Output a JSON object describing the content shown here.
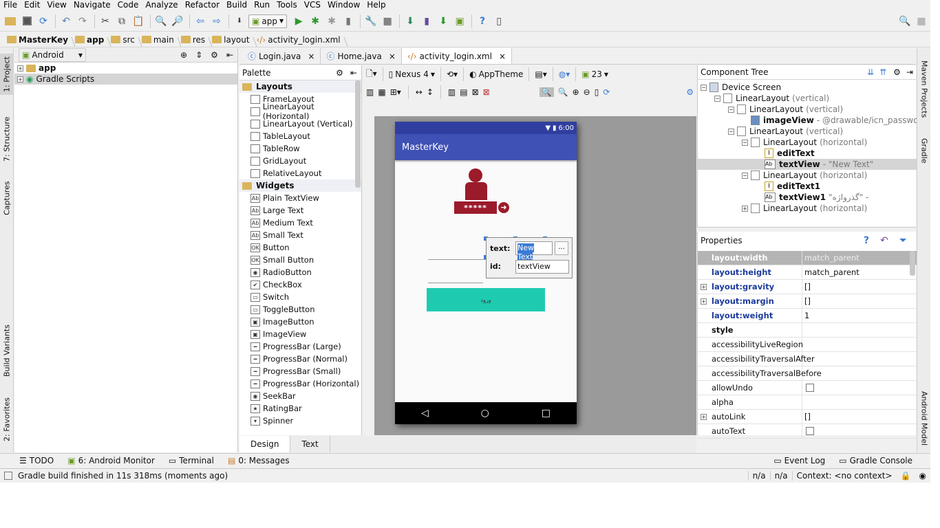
{
  "menu": [
    "File",
    "Edit",
    "View",
    "Navigate",
    "Code",
    "Analyze",
    "Refactor",
    "Build",
    "Run",
    "Tools",
    "VCS",
    "Window",
    "Help"
  ],
  "toolbar": {
    "run_config": "app"
  },
  "breadcrumb": [
    "MasterKey",
    "app",
    "src",
    "main",
    "res",
    "layout",
    "activity_login.xml"
  ],
  "left_tabs": {
    "project": "1: Project",
    "structure": "7: Structure",
    "captures": "Captures",
    "build_variants": "Build Variants",
    "favorites": "2: Favorites"
  },
  "right_tabs": {
    "maven": "Maven Projects",
    "gradle": "Gradle",
    "android_model": "Android Model"
  },
  "project": {
    "view_mode": "Android",
    "items": [
      "app",
      "Gradle Scripts"
    ]
  },
  "editor_tabs": [
    "Login.java",
    "Home.java",
    "activity_login.xml"
  ],
  "palette": {
    "title": "Palette",
    "layouts_title": "Layouts",
    "layouts": [
      "FrameLayout",
      "LinearLayout (Horizontal)",
      "LinearLayout (Vertical)",
      "TableLayout",
      "TableRow",
      "GridLayout",
      "RelativeLayout"
    ],
    "widgets_title": "Widgets",
    "widgets": [
      "Plain TextView",
      "Large Text",
      "Medium Text",
      "Small Text",
      "Button",
      "Small Button",
      "RadioButton",
      "CheckBox",
      "Switch",
      "ToggleButton",
      "ImageButton",
      "ImageView",
      "ProgressBar (Large)",
      "ProgressBar (Normal)",
      "ProgressBar (Small)",
      "ProgressBar (Horizontal)",
      "SeekBar",
      "RatingBar",
      "Spinner"
    ]
  },
  "editor_toolbar": {
    "device": "Nexus 4",
    "theme": "AppTheme",
    "api": "23"
  },
  "device": {
    "time": "6:00",
    "app_title": "MasterKey",
    "password_mask": "*****",
    "button_text": "ورود",
    "colors": {
      "status": "#303f9f",
      "appbar": "#3f51b5",
      "primary_dark": "#9b1b2a",
      "button": "#1ecbb1"
    }
  },
  "popup": {
    "text_label": "text:",
    "text_value": "New Text",
    "id_label": "id:",
    "id_value": "textView",
    "more": "..."
  },
  "design_tabs": [
    "Design",
    "Text"
  ],
  "component_tree": {
    "title": "Component Tree",
    "nodes": [
      {
        "name": "Device Screen",
        "detail": ""
      },
      {
        "name": "LinearLayout",
        "detail": "(vertical)"
      },
      {
        "name": "LinearLayout",
        "detail": "(vertical)"
      },
      {
        "name": "imageView",
        "detail": "- @drawable/icn_password"
      },
      {
        "name": "LinearLayout",
        "detail": "(vertical)"
      },
      {
        "name": "LinearLayout",
        "detail": "(horizontal)"
      },
      {
        "name": "editText",
        "detail": ""
      },
      {
        "name": "textView",
        "detail": "- \"New Text\""
      },
      {
        "name": "LinearLayout",
        "detail": "(horizontal)"
      },
      {
        "name": "editText1",
        "detail": ""
      },
      {
        "name": "textView1",
        "detail": "\"گذرواژه\" -"
      },
      {
        "name": "LinearLayout",
        "detail": "(horizontal)"
      }
    ]
  },
  "properties": {
    "title": "Properties",
    "rows": [
      {
        "name": "layout:width",
        "value": "match_parent"
      },
      {
        "name": "layout:height",
        "value": "match_parent"
      },
      {
        "name": "layout:gravity",
        "value": "[]"
      },
      {
        "name": "layout:margin",
        "value": "[]"
      },
      {
        "name": "layout:weight",
        "value": "1"
      },
      {
        "name": "style",
        "value": ""
      },
      {
        "name": "accessibilityLiveRegion",
        "value": ""
      },
      {
        "name": "accessibilityTraversalAfter",
        "value": ""
      },
      {
        "name": "accessibilityTraversalBefore",
        "value": ""
      },
      {
        "name": "allowUndo",
        "value": ""
      },
      {
        "name": "alpha",
        "value": ""
      },
      {
        "name": "autoLink",
        "value": "[]"
      },
      {
        "name": "autoText",
        "value": ""
      }
    ]
  },
  "tool_windows": {
    "todo": "TODO",
    "android_monitor": "6: Android Monitor",
    "terminal": "Terminal",
    "messages": "0: Messages",
    "event_log": "Event Log",
    "gradle_console": "Gradle Console"
  },
  "status": {
    "message": "Gradle build finished in 11s 318ms (moments ago)",
    "na1": "n/a",
    "na2": "n/a",
    "context": "Context: <no context>"
  }
}
